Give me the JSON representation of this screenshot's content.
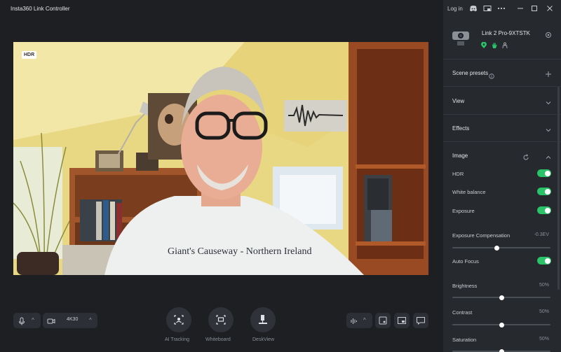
{
  "app": {
    "title": "Insta360 Link Controller"
  },
  "window": {
    "login": "Log in"
  },
  "video": {
    "badge": "HDR"
  },
  "toolbar": {
    "resolution": "4K30",
    "ai_tracking": "AI Tracking",
    "whiteboard": "Whiteboard",
    "deskview": "DeskView"
  },
  "sidebar": {
    "device_name": "Link 2 Pro-9XTSTK",
    "scene_presets": "Scene presets",
    "view": "View",
    "effects": "Effects",
    "image": {
      "title": "Image",
      "hdr": {
        "label": "HDR",
        "on": true
      },
      "white_balance": {
        "label": "White balance",
        "on": true
      },
      "exposure": {
        "label": "Exposure",
        "on": true
      },
      "exposure_comp": {
        "label": "Exposure Compensation",
        "value": "-0.3EV",
        "level": 0.45
      },
      "auto_focus": {
        "label": "Auto Focus",
        "on": true
      },
      "brightness": {
        "label": "Brightness",
        "value": "50%",
        "level": 0.5
      },
      "contrast": {
        "label": "Contrast",
        "value": "50%",
        "level": 0.5
      },
      "saturation": {
        "label": "Saturation",
        "value": "50%",
        "level": 0.5
      }
    }
  },
  "colors": {
    "toggle_on": "#2ac36a",
    "accent_green": "#2ac36a"
  }
}
